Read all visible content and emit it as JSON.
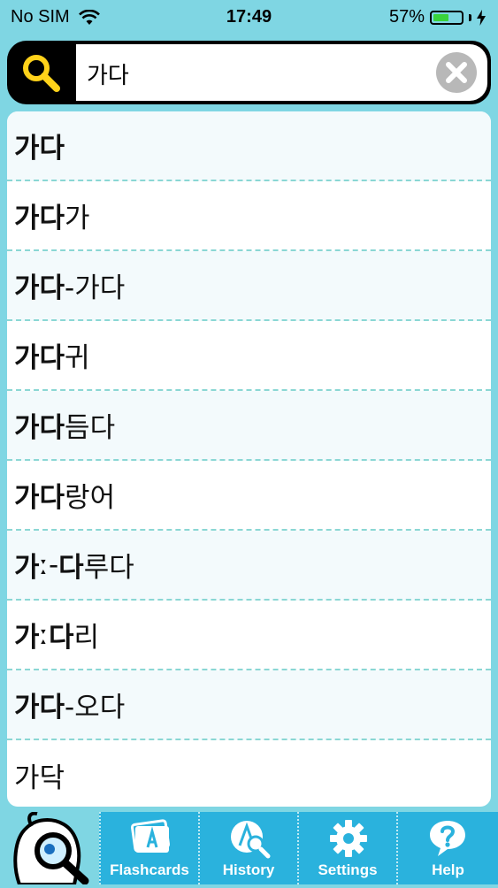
{
  "status_bar": {
    "carrier": "No SIM",
    "time": "17:49",
    "battery": "57%",
    "battery_level": 0.57
  },
  "search": {
    "query": "가다"
  },
  "results": [
    {
      "match": "가다",
      "rest": ""
    },
    {
      "match": "가다",
      "rest": "가"
    },
    {
      "match": "가다",
      "rest": "-가다"
    },
    {
      "match": "가다",
      "rest": "귀"
    },
    {
      "match": "가다",
      "rest": "듬다"
    },
    {
      "match": "가다",
      "rest": "랑어"
    },
    {
      "match": "",
      "rest": "",
      "parts": [
        "가",
        "ː-",
        "다",
        "루다"
      ]
    },
    {
      "match": "",
      "rest": "",
      "parts": [
        "가",
        "ː",
        "다",
        "리"
      ]
    },
    {
      "match": "가다",
      "rest": "-오다"
    },
    {
      "match": "",
      "rest": "가닥"
    }
  ],
  "tabs": [
    {
      "label": "Flashcards",
      "icon": "flashcards-icon"
    },
    {
      "label": "History",
      "icon": "history-icon"
    },
    {
      "label": "Settings",
      "icon": "gear-icon"
    },
    {
      "label": "Help",
      "icon": "help-icon"
    }
  ],
  "colors": {
    "background": "#7fd6e3",
    "tab_bar": "#2ab2dd",
    "search_icon": "#ffd21a",
    "divider": "#8ad7d4"
  }
}
